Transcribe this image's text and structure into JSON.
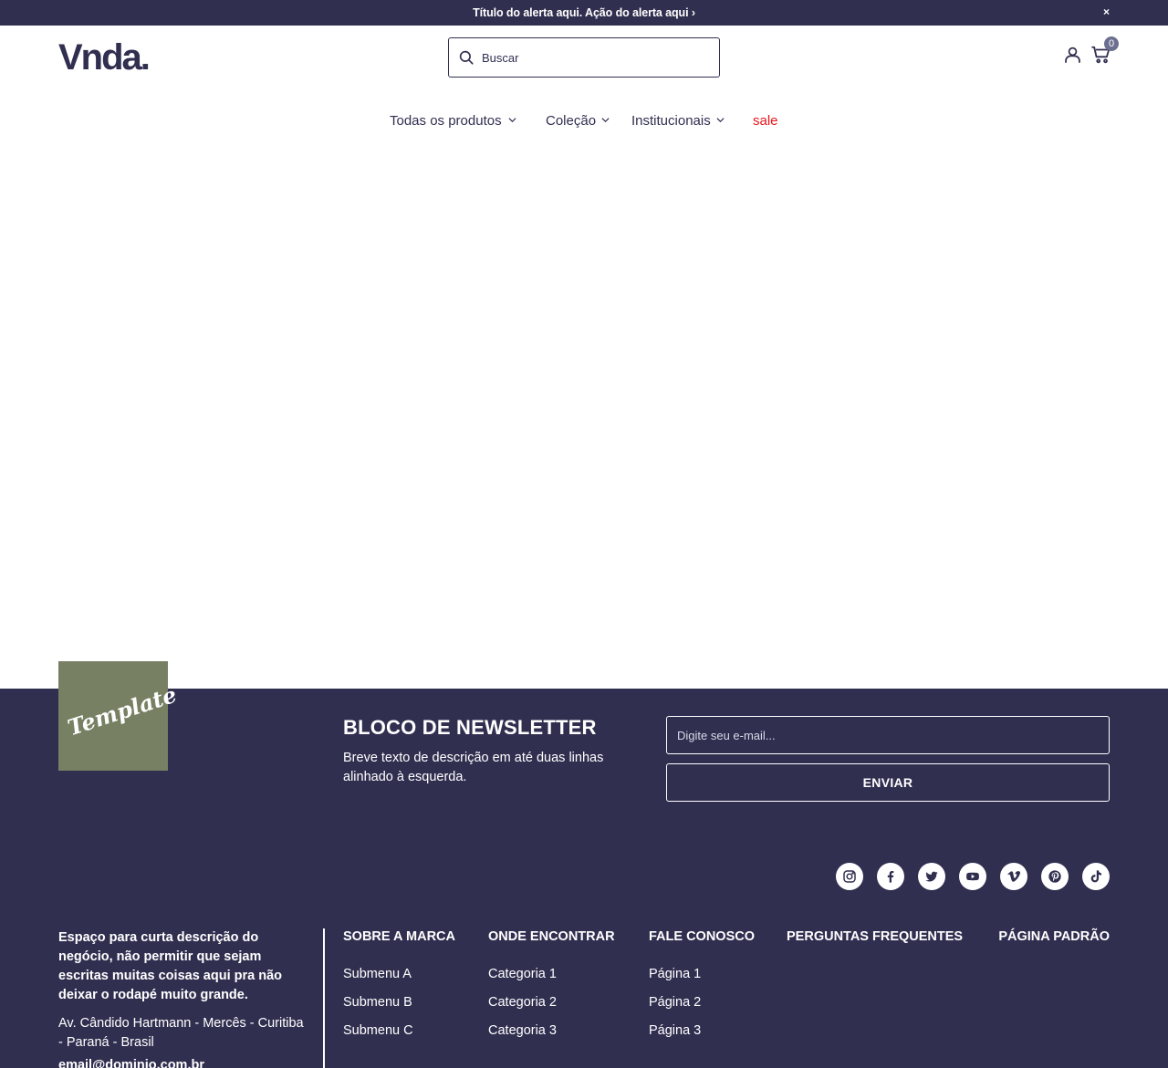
{
  "alert": {
    "text": "Título do alerta aqui. Ação do alerta aqui ›",
    "close": "×"
  },
  "header": {
    "logo": "Vnda.",
    "search_placeholder": "Buscar",
    "cart_count": "0"
  },
  "nav": {
    "items": [
      {
        "label": "Todas os produtos",
        "has_dropdown": true
      },
      {
        "label": "Coleção",
        "has_dropdown": true
      },
      {
        "label": "Institucionais",
        "has_dropdown": true
      },
      {
        "label": "sale",
        "has_dropdown": false
      }
    ]
  },
  "footer": {
    "badge_text": "Template",
    "newsletter": {
      "title": "BLOCO DE NEWSLETTER",
      "description": "Breve texto de descrição em até duas linhas alinhado à esquerda.",
      "email_placeholder": "Digite seu e-mail...",
      "button": "ENVIAR"
    },
    "social_icons": [
      "instagram-icon",
      "facebook-icon",
      "twitter-icon",
      "youtube-icon",
      "vimeo-icon",
      "pinterest-icon",
      "tiktok-icon"
    ],
    "about": "Espaço para curta descrição do negócio, não permitir que sejam escritas muitas coisas aqui pra não deixar o rodapé muito grande.",
    "address": "Av. Cândido Hartmann - Mercês - Curitiba - Paraná - Brasil",
    "email": "email@dominio.com.br",
    "columns": [
      {
        "title": "SOBRE A MARCA",
        "links": [
          "Submenu A",
          "Submenu B",
          "Submenu C"
        ]
      },
      {
        "title": "ONDE ENCONTRAR",
        "links": [
          "Categoria 1",
          "Categoria 2",
          "Categoria 3"
        ]
      },
      {
        "title": "FALE CONOSCO",
        "links": [
          "Página 1",
          "Página 2",
          "Página 3"
        ]
      },
      {
        "title": "PERGUNTAS FREQUENTES",
        "links": []
      },
      {
        "title": "PÁGINA PADRÃO",
        "links": []
      }
    ]
  },
  "colors": {
    "primary": "#312f50",
    "sale": "#e8141b",
    "badge": "#778062"
  }
}
